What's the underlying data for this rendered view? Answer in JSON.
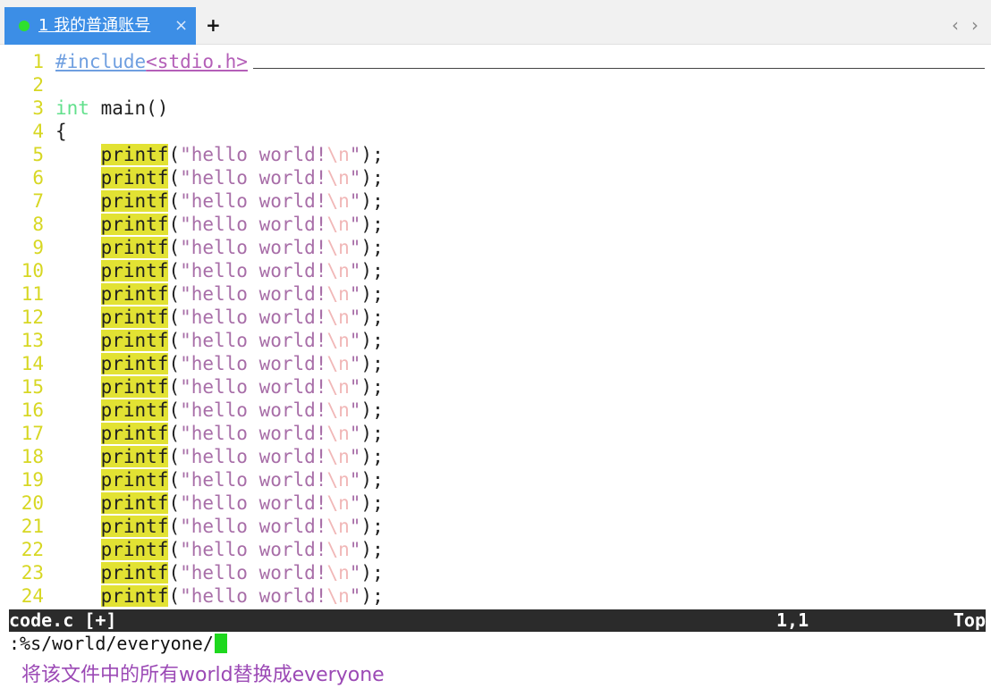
{
  "tabs": {
    "active_label": "1 我的普通账号",
    "close_glyph": "×",
    "new_tab_glyph": "+",
    "prev_glyph": "‹",
    "next_glyph": "›"
  },
  "editor": {
    "line_numbers": [
      "1",
      "2",
      "3",
      "4",
      "5",
      "6",
      "7",
      "8",
      "9",
      "10",
      "11",
      "12",
      "13",
      "14",
      "15",
      "16",
      "17",
      "18",
      "19",
      "20",
      "21",
      "22",
      "23",
      "24"
    ],
    "include_directive": "#include",
    "include_header": "<stdio.h>",
    "type_keyword": "int",
    "main_signature": " main()",
    "open_brace": "{",
    "indent": "    ",
    "call_name": "printf",
    "call_open": "(",
    "string_body": "\"hello world!",
    "escape_seq": "\\n",
    "string_close": "\"",
    "call_end": ");"
  },
  "statusbar": {
    "filename": "code.c [+]",
    "position": "1,1",
    "scroll": "Top"
  },
  "command_line": {
    "text": ":%s/world/everyone/"
  },
  "annotation": {
    "text": "将该文件中的所有world替换成everyone"
  },
  "colors": {
    "tab_active": "#3c8ee6",
    "line_number": "#d7d723",
    "function_highlight": "#e2e233",
    "string": "#a86ea8",
    "keyword": "#62e08c",
    "cursor": "#1ed81e",
    "annotation": "#9b49b5"
  }
}
